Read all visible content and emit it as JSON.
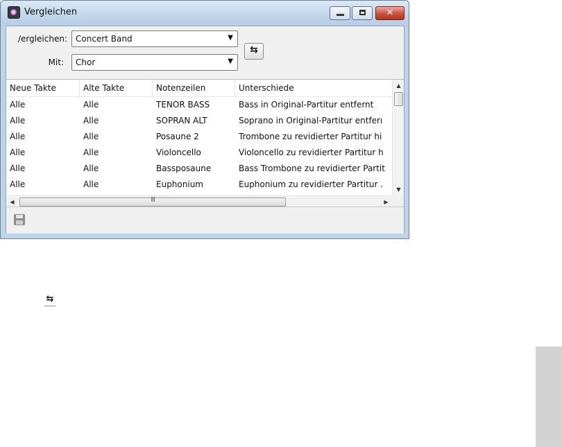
{
  "window": {
    "title": "Vergleichen",
    "close_glyph": "✕"
  },
  "form": {
    "compare_label": "/ergleichen:",
    "compare_value": "Concert Band",
    "with_label": "Mit:",
    "with_value": "Chor",
    "dropdown_arrow": "▼",
    "swap_glyph": "⇆"
  },
  "table": {
    "columns": [
      "Neue Takte",
      "Alte Takte",
      "Notenzeilen",
      "Unterschiede"
    ],
    "rows": [
      [
        "Alle",
        "Alle",
        "TENOR BASS",
        "Bass in Original-Partitur entfernt"
      ],
      [
        "Alle",
        "Alle",
        "SOPRAN ALT",
        "Soprano in Original-Partitur entferı"
      ],
      [
        "Alle",
        "Alle",
        "Posaune 2",
        "Trombone zu revidierter Partitur hi"
      ],
      [
        "Alle",
        "Alle",
        "Violoncello",
        "Violoncello zu revidierter Partitur h"
      ],
      [
        "Alle",
        "Alle",
        "Bassposaune",
        "Bass Trombone zu revidierter Partit"
      ],
      [
        "Alle",
        "Alle",
        "Euphonium",
        "Euphonium zu revidierter Partitur ."
      ]
    ],
    "scroll_up": "▲",
    "scroll_down": "▼",
    "scroll_left": "◀",
    "scroll_right": "▶",
    "hgrip": "III"
  },
  "standalone_icon": {
    "glyph": "⇆",
    "icon": "swap-icon"
  },
  "icons": {
    "app": "app-icon",
    "save": "save-icon",
    "swap": "swap-icon"
  }
}
